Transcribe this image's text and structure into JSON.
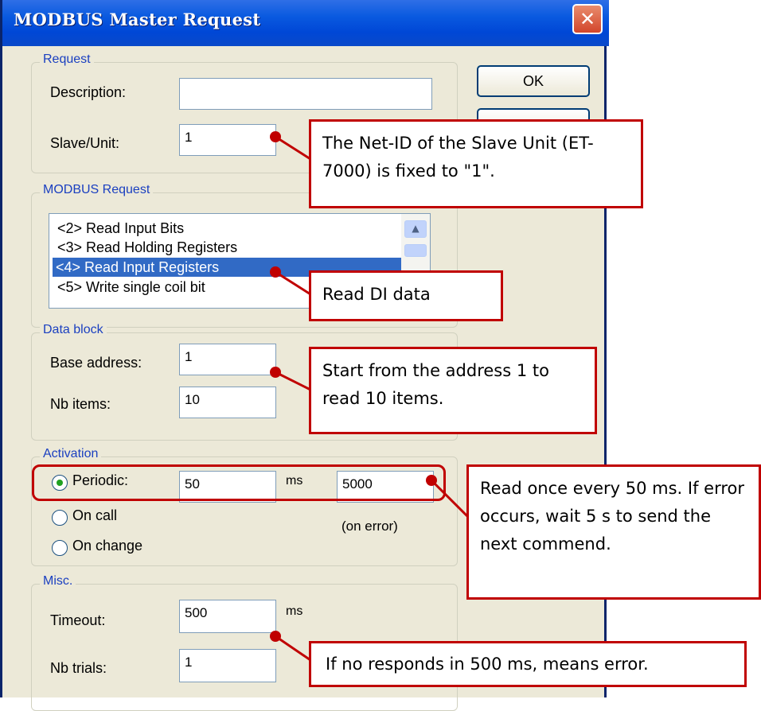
{
  "window": {
    "title": "MODBUS Master Request",
    "close_icon": "close-icon"
  },
  "buttons": {
    "ok": "OK"
  },
  "request": {
    "legend": "Request",
    "description_label": "Description:",
    "description_value": "",
    "slave_label": "Slave/Unit:",
    "slave_value": "1"
  },
  "modbus_request": {
    "legend": "MODBUS Request",
    "items": [
      "<2> Read Input Bits",
      "<3> Read Holding Registers",
      "<4> Read Input Registers",
      "<5> Write single coil bit"
    ],
    "selected_index": 2
  },
  "data_block": {
    "legend": "Data block",
    "base_label": "Base address:",
    "base_value": "1",
    "nb_label": "Nb items:",
    "nb_value": "10"
  },
  "activation": {
    "legend": "Activation",
    "periodic_label": "Periodic:",
    "periodic_value": "50",
    "ms_label": "ms",
    "error_value": "5000",
    "on_call_label": "On call",
    "on_change_label": "On change",
    "on_error_label": "(on error)",
    "selected": "Periodic"
  },
  "misc": {
    "legend": "Misc.",
    "timeout_label": "Timeout:",
    "timeout_value": "500",
    "ms_label": "ms",
    "trials_label": "Nb trials:",
    "trials_value": "1"
  },
  "annotations": {
    "slave": "The Net-ID of the Slave Unit (ET-7000) is fixed to \"1\".",
    "read_di": "Read DI data",
    "address": "Start from the address 1 to read 10 items.",
    "periodic": "Read once every 50 ms. If error occurs, wait 5 s to send the next commend.",
    "timeout": "If no responds in 500 ms, means error."
  },
  "colors": {
    "annotation": "#c00000",
    "selection": "#316ac5",
    "titlebar": "#0a5ae0"
  }
}
